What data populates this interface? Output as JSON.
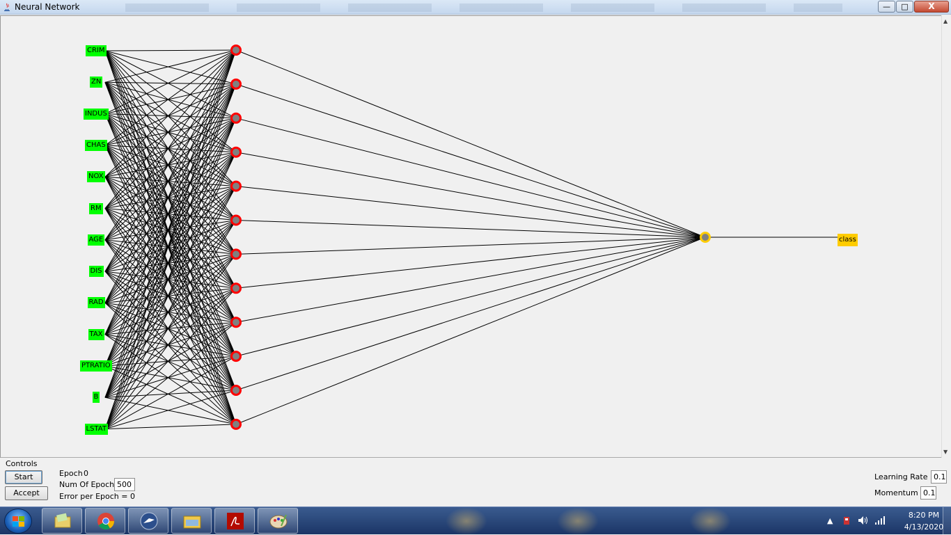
{
  "window": {
    "title": "Neural Network",
    "controls": {
      "minimize": "—",
      "maximize": "□",
      "close": "X"
    }
  },
  "network": {
    "inputs": [
      "CRIM",
      "ZN",
      "INDUS",
      "CHAS",
      "NOX",
      "RM",
      "AGE",
      "DIS",
      "RAD",
      "TAX",
      "PTRATIO",
      "B",
      "LSTAT"
    ],
    "hidden_node_count": 12,
    "output_node_count": 1,
    "output_label": "class",
    "colors": {
      "input": "#00ff00",
      "hidden_ring": "#ff0000",
      "node_fill": "#808080",
      "output": "#ffcc00",
      "edges": "#000000"
    }
  },
  "controls": {
    "caption": "Controls",
    "start_label": "Start",
    "accept_label": "Accept",
    "epoch_label": "Epoch",
    "epoch_value": "0",
    "num_epochs_label": "Num Of Epochs",
    "num_epochs_value": "500",
    "error_label": "Error per Epoch = 0",
    "learning_rate_label": "Learning Rate =",
    "learning_rate_value": "0.1",
    "momentum_label": "Momentum =",
    "momentum_value": "0.1"
  },
  "taskbar": {
    "apps": [
      "folder-icon",
      "chrome-icon",
      "eagle-icon",
      "explorer-icon",
      "pdf-icon",
      "paint-icon"
    ],
    "clock_time": "8:20 PM",
    "clock_date": "4/13/2020",
    "tray_icons": [
      "show-hidden-icon",
      "network-alert-icon",
      "volume-icon",
      "signal-icon"
    ],
    "tray_arrow": "▲"
  }
}
